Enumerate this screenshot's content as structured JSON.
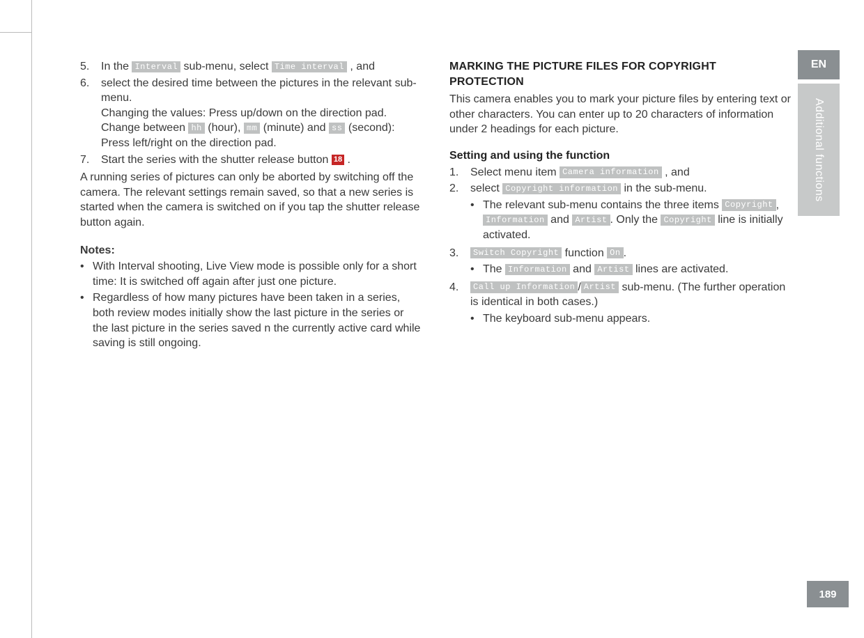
{
  "sidebar": {
    "lang": "EN",
    "section": "Additional functions",
    "page_number": "189"
  },
  "left": {
    "items": {
      "5": {
        "pre": "In the ",
        "box1": "Interval",
        "mid": " sub-menu, select ",
        "box2": "Time interval",
        "post": ", and"
      },
      "6": {
        "line1": "select the desired time between the pictures in the relevant sub-menu.",
        "line2_pre": "Changing the values: Press up/down on the direction pad. Change between ",
        "hh": "hh",
        "hh_after": " (hour), ",
        "mm": "mm",
        "mm_after": " (minute) and ",
        "ss": "ss",
        "ss_after": " (second): Press left/right on the direction pad."
      },
      "7": {
        "pre": "Start the series with the shutter release button ",
        "red": "18",
        "post": "."
      }
    },
    "running_para": "A running series of pictures can only be aborted by switching off the camera. The relevant settings remain saved, so that a new series is started when the camera is switched on if you tap the shutter release button again.",
    "notes_label": "Notes:",
    "notes": [
      "With Interval shooting, Live View mode is possible only for a short time: It is switched off again after just one picture.",
      "Regardless of how many pictures have been taken in a series, both review modes initially show the last picture in the series or the last picture in the series saved n the currently active card while saving is still ongoing."
    ]
  },
  "right": {
    "heading": "MARKING THE PICTURE FILES FOR COPYRIGHT PROTECTION",
    "intro": "This camera enables you to mark your picture files by entering text or other characters. You can enter up to 20 characters of information under 2 headings for each picture.",
    "subheading": "Setting and using the function",
    "steps": {
      "1": {
        "pre": "Select menu item ",
        "box": "Camera information",
        "post": ", and"
      },
      "2": {
        "pre": "select ",
        "box": "Copyright information",
        "post": " in the sub-menu.",
        "bullet_pre": "The relevant sub-menu contains the three items ",
        "b1": "Copyright",
        "b_sep1": ", ",
        "b2": "Information",
        "b_sep2": " and ",
        "b3": "Artist",
        "b_sep3": ". Only the ",
        "b4": "Copyright",
        "b_tail": " line is initially activated."
      },
      "3": {
        "box1": "Switch Copyright",
        "mid": " function ",
        "box2": "On",
        "post": ".",
        "bullet_pre": "The ",
        "b1": "Information",
        "b_sep1": " and ",
        "b2": "Artist",
        "b_tail": " lines are activated."
      },
      "4": {
        "box1": "Call up Information",
        "slash": "/",
        "box2": "Artist",
        "post": " sub-menu. (The further operation is identical in both cases.)",
        "bullet": "The keyboard sub-menu appears."
      }
    }
  }
}
